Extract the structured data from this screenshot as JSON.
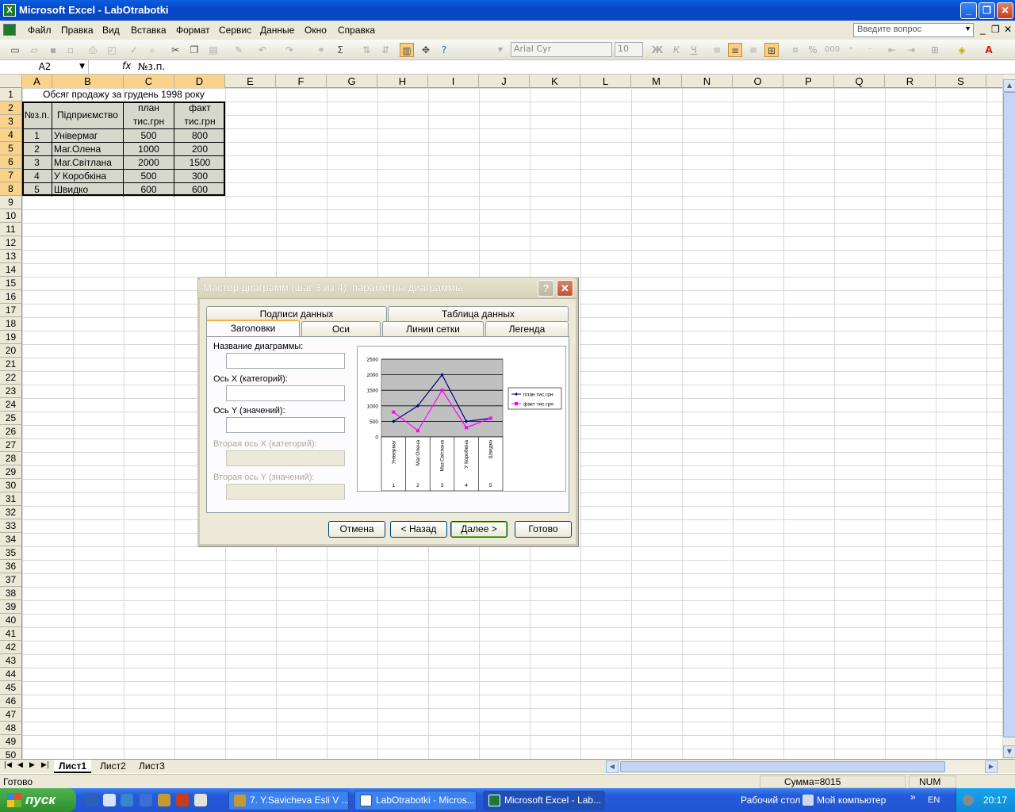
{
  "window": {
    "title": "Microsoft Excel - LabOtrabotki",
    "buttons": [
      "_",
      "❐",
      "✕"
    ]
  },
  "menu": {
    "items": [
      "Файл",
      "Правка",
      "Вид",
      "Вставка",
      "Формат",
      "Сервис",
      "Данные",
      "Окно",
      "Справка"
    ],
    "question_placeholder": "Введите вопрос",
    "doc_buttons": [
      "_",
      "❐",
      "✕"
    ]
  },
  "toolbar": {
    "font": "Arial Cyr",
    "size": "10",
    "bold": "Ж",
    "italic": "К",
    "underline": "Ч",
    "percent": "%",
    "thousands": "000"
  },
  "formula_bar": {
    "name_box": "A2",
    "fx": "fx",
    "content": "№з.п."
  },
  "columns": [
    "A",
    "B",
    "C",
    "D",
    "E",
    "F",
    "G",
    "H",
    "I",
    "J",
    "K",
    "L",
    "M",
    "N",
    "O",
    "P",
    "Q",
    "R",
    "S"
  ],
  "rows": [
    "1",
    "2",
    "3",
    "4",
    "5",
    "6",
    "7",
    "8",
    "9",
    "10",
    "11",
    "12",
    "13",
    "14",
    "15",
    "16",
    "17",
    "18",
    "19",
    "20",
    "21",
    "22",
    "23",
    "24",
    "25",
    "26",
    "27",
    "28",
    "29",
    "30",
    "31",
    "32",
    "33",
    "34",
    "35",
    "36",
    "37",
    "38",
    "39",
    "40",
    "41",
    "42",
    "43",
    "44",
    "45",
    "46",
    "47",
    "48",
    "49",
    "50"
  ],
  "sheet": {
    "title": "Обсяг продажу за грудень 1998 року",
    "h_num": "№з.п.",
    "h_company": "Підприємство",
    "h_plan_1": "план",
    "h_plan_2": "тис.грн",
    "h_fact_1": "факт",
    "h_fact_2": "тис.грн",
    "data": [
      {
        "n": "1",
        "name": "Універмаг",
        "plan": "500",
        "fact": "800"
      },
      {
        "n": "2",
        "name": "Маг.Олена",
        "plan": "1000",
        "fact": "200"
      },
      {
        "n": "3",
        "name": "Маг.Світлана",
        "plan": "2000",
        "fact": "1500"
      },
      {
        "n": "4",
        "name": "У Коробкіна",
        "plan": "500",
        "fact": "300"
      },
      {
        "n": "5",
        "name": "Швидко",
        "plan": "600",
        "fact": "600"
      }
    ]
  },
  "sheet_tabs": [
    "Лист1",
    "Лист2",
    "Лист3"
  ],
  "status": {
    "ready": "Готово",
    "sum": "Сумма=8015",
    "num": "NUM"
  },
  "dialog": {
    "title": "Мастер диаграмм (шаг 3 из 4): параметры диаграммы",
    "help": "?",
    "close": "✕",
    "tabs_back": [
      "Подписи данных",
      "Таблица данных"
    ],
    "tabs_front": [
      "Заголовки",
      "Оси",
      "Линии сетки",
      "Легенда"
    ],
    "fields": {
      "chart_title": "Название диаграммы:",
      "x_axis": "Ось X (категорий):",
      "y_axis": "Ось Y (значений):",
      "x2_axis": "Вторая ось X (категорий):",
      "y2_axis": "Вторая ось Y (значений):"
    },
    "buttons": {
      "cancel": "Отмена",
      "back": "< Назад",
      "next": "Далее >",
      "finish": "Готово"
    }
  },
  "chart_data": {
    "type": "line",
    "categories": [
      "Універмаг",
      "Маг.Олена",
      "Маг.Світлана",
      "У Коробкіна",
      "Швидко"
    ],
    "category_numbers": [
      "1",
      "2",
      "3",
      "4",
      "5"
    ],
    "series": [
      {
        "name": "план тис.грн",
        "values": [
          500,
          1000,
          2000,
          500,
          600
        ],
        "color": "#000080"
      },
      {
        "name": "факт тис.грн",
        "values": [
          800,
          200,
          1500,
          300,
          600
        ],
        "color": "#ff00ff"
      }
    ],
    "ylim": [
      0,
      2500
    ],
    "yticks": [
      "0",
      "500",
      "1000",
      "1500",
      "2000",
      "2500"
    ],
    "grid": true,
    "legend": "right",
    "plot_bg": "#c0c0c0"
  },
  "taskbar": {
    "start": "пуск",
    "tasks": [
      "7. Y.Savicheva Esli V ...",
      "LabOtrabotki - Micros...",
      "Microsoft Excel - Lab..."
    ],
    "desktop": "Рабочий стол",
    "computer": "Мой компьютер",
    "lang": "EN",
    "time": "20:17"
  }
}
